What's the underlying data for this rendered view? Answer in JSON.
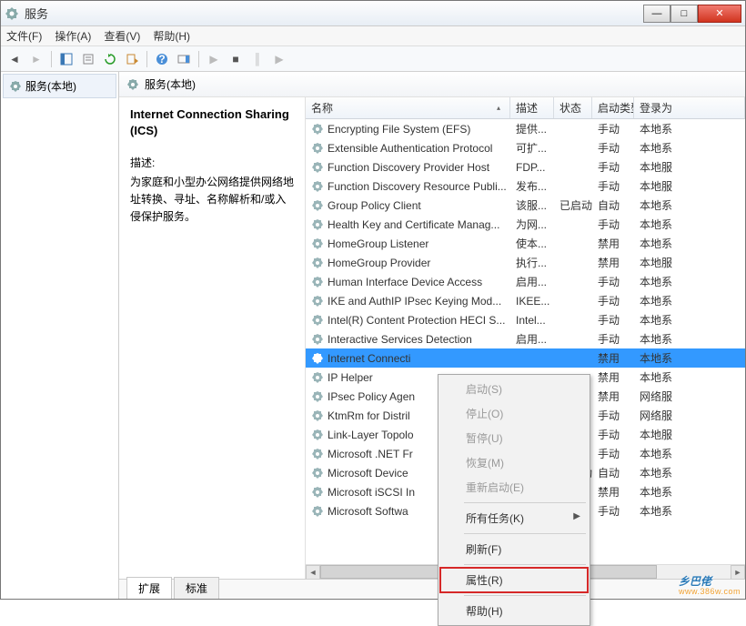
{
  "title": "服务",
  "menu": [
    "文件(F)",
    "操作(A)",
    "查看(V)",
    "帮助(H)"
  ],
  "nav_label": "服务(本地)",
  "content_header": "服务(本地)",
  "detail": {
    "name": "Internet Connection Sharing (ICS)",
    "label": "描述:",
    "desc": "为家庭和小型办公网络提供网络地址转换、寻址、名称解析和/或入侵保护服务。"
  },
  "columns": {
    "name": "名称",
    "desc": "描述",
    "state": "状态",
    "start": "启动类型",
    "logon": "登录为"
  },
  "rows": [
    {
      "name": "Encrypting File System (EFS)",
      "desc": "提供...",
      "state": "",
      "start": "手动",
      "logon": "本地系"
    },
    {
      "name": "Extensible Authentication Protocol",
      "desc": "可扩...",
      "state": "",
      "start": "手动",
      "logon": "本地系"
    },
    {
      "name": "Function Discovery Provider Host",
      "desc": "FDP...",
      "state": "",
      "start": "手动",
      "logon": "本地服"
    },
    {
      "name": "Function Discovery Resource Publi...",
      "desc": "发布...",
      "state": "",
      "start": "手动",
      "logon": "本地服"
    },
    {
      "name": "Group Policy Client",
      "desc": "该服...",
      "state": "已启动",
      "start": "自动",
      "logon": "本地系"
    },
    {
      "name": "Health Key and Certificate Manag...",
      "desc": "为网...",
      "state": "",
      "start": "手动",
      "logon": "本地系"
    },
    {
      "name": "HomeGroup Listener",
      "desc": "使本...",
      "state": "",
      "start": "禁用",
      "logon": "本地系"
    },
    {
      "name": "HomeGroup Provider",
      "desc": "执行...",
      "state": "",
      "start": "禁用",
      "logon": "本地服"
    },
    {
      "name": "Human Interface Device Access",
      "desc": "启用...",
      "state": "",
      "start": "手动",
      "logon": "本地系"
    },
    {
      "name": "IKE and AuthIP IPsec Keying Mod...",
      "desc": "IKEE...",
      "state": "",
      "start": "手动",
      "logon": "本地系"
    },
    {
      "name": "Intel(R) Content Protection HECI S...",
      "desc": "Intel...",
      "state": "",
      "start": "手动",
      "logon": "本地系"
    },
    {
      "name": "Interactive Services Detection",
      "desc": "启用...",
      "state": "",
      "start": "手动",
      "logon": "本地系"
    },
    {
      "name": "Internet Connecti",
      "desc": "",
      "state": "",
      "start": "禁用",
      "logon": "本地系",
      "selected": true
    },
    {
      "name": "IP Helper",
      "desc": "",
      "state": "",
      "start": "禁用",
      "logon": "本地系"
    },
    {
      "name": "IPsec Policy Agen",
      "desc": "",
      "state": "",
      "start": "禁用",
      "logon": "网络服"
    },
    {
      "name": "KtmRm for Distril",
      "desc": "",
      "state": "",
      "start": "手动",
      "logon": "网络服"
    },
    {
      "name": "Link-Layer Topolo",
      "desc": "",
      "state": "",
      "start": "手动",
      "logon": "本地服"
    },
    {
      "name": "Microsoft .NET Fr",
      "desc": "",
      "state": "",
      "start": "手动",
      "logon": "本地系"
    },
    {
      "name": "Microsoft Device",
      "desc": "",
      "state": "已启动",
      "start": "自动",
      "logon": "本地系"
    },
    {
      "name": "Microsoft iSCSI In",
      "desc": "",
      "state": "",
      "start": "禁用",
      "logon": "本地系"
    },
    {
      "name": "Microsoft Softwa",
      "desc": "",
      "state": "",
      "start": "手动",
      "logon": "本地系"
    }
  ],
  "context_menu": [
    {
      "label": "启动(S)",
      "disabled": true
    },
    {
      "label": "停止(O)",
      "disabled": true
    },
    {
      "label": "暂停(U)",
      "disabled": true
    },
    {
      "label": "恢复(M)",
      "disabled": true
    },
    {
      "label": "重新启动(E)",
      "disabled": true
    },
    {
      "sep": true
    },
    {
      "label": "所有任务(K)",
      "arrow": true
    },
    {
      "sep": true
    },
    {
      "label": "刷新(F)"
    },
    {
      "sep": true
    },
    {
      "label": "属性(R)",
      "highlight": true
    },
    {
      "sep": true
    },
    {
      "label": "帮助(H)"
    }
  ],
  "tabs": {
    "extended": "扩展",
    "standard": "标准"
  },
  "logo": {
    "text": "乡巴佬",
    "sub": "www.386w.com"
  }
}
